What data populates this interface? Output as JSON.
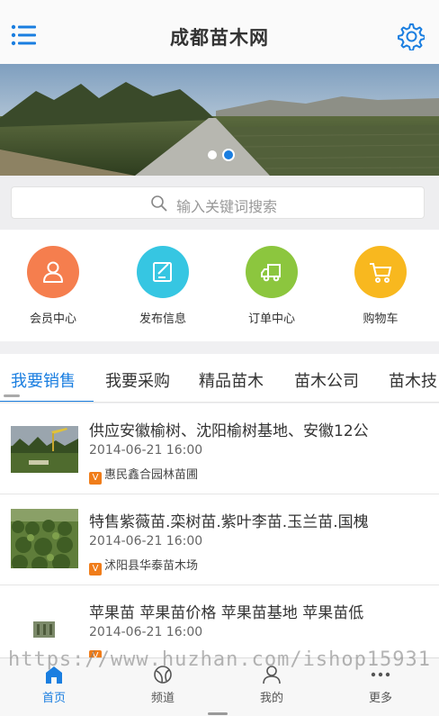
{
  "header": {
    "title": "成都苗木网",
    "menu_icon": "menu-icon",
    "settings_icon": "gear-icon"
  },
  "banner": {
    "slide_count": 2,
    "active_slide": 2
  },
  "search": {
    "placeholder": "输入关键词搜索"
  },
  "quick_nav": [
    {
      "label": "会员中心",
      "icon": "user-icon",
      "color": "#f57e4e"
    },
    {
      "label": "发布信息",
      "icon": "edit-icon",
      "color": "#36c6e2"
    },
    {
      "label": "订单中心",
      "icon": "truck-icon",
      "color": "#8cc63e"
    },
    {
      "label": "购物车",
      "icon": "cart-icon",
      "color": "#f8b81f"
    }
  ],
  "tabs": [
    {
      "label": "我要销售",
      "active": true
    },
    {
      "label": "我要采购"
    },
    {
      "label": "精品苗木"
    },
    {
      "label": "苗木公司"
    },
    {
      "label": "苗木技"
    }
  ],
  "listings": [
    {
      "title": "供应安徽榆树、沈阳榆树基地、安徽12公",
      "date": "2014-06-21 16:00",
      "company": "惠民鑫合园林苗圃",
      "badge": "V"
    },
    {
      "title": "特售紫薇苗.栾树苗.紫叶李苗.玉兰苗.国槐",
      "date": "2014-06-21 16:00",
      "company": "沭阳县华泰苗木场",
      "badge": "V"
    },
    {
      "title": "苹果苗 苹果苗价格 苹果苗基地 苹果苗低",
      "date": "2014-06-21 16:00",
      "company": "",
      "badge": "V"
    }
  ],
  "bottom_nav": [
    {
      "label": "首页",
      "icon": "home-icon",
      "active": true
    },
    {
      "label": "频道",
      "icon": "channel-icon"
    },
    {
      "label": "我的",
      "icon": "profile-icon"
    },
    {
      "label": "更多",
      "icon": "more-icon"
    }
  ],
  "watermark": "https://www.huzhan.com/ishop15931",
  "colors": {
    "accent": "#1a7ee0",
    "badge": "#f07d1a"
  }
}
